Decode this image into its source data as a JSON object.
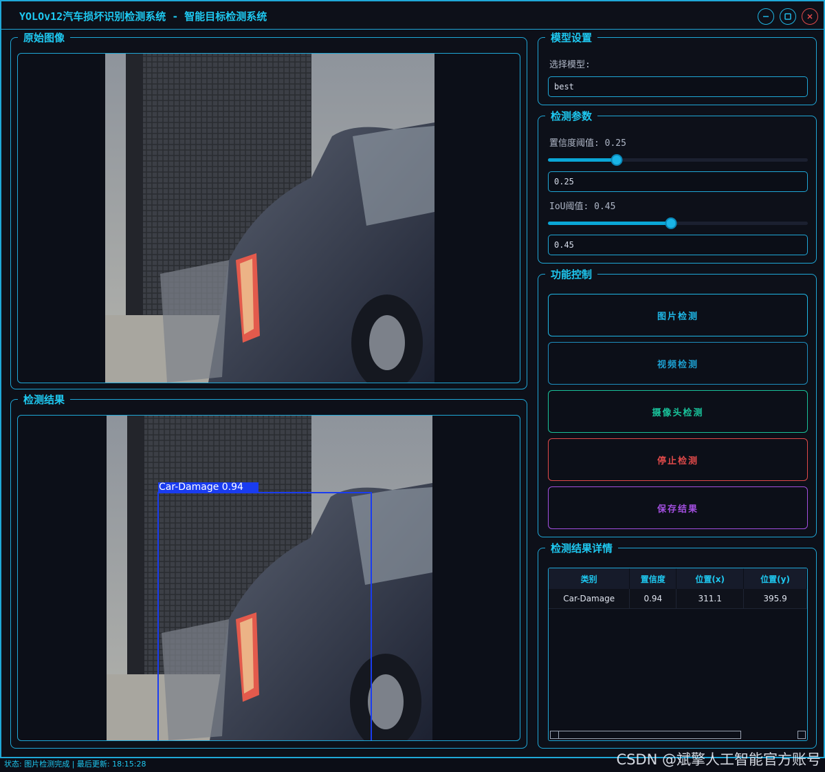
{
  "window": {
    "title": "YOLOv12汽车损坏识别检测系统 - 智能目标检测系统"
  },
  "panels": {
    "original_title": "原始图像",
    "result_title": "检测结果"
  },
  "detection_overlay": {
    "label": "Car-Damage 0.94"
  },
  "model_settings": {
    "title": "模型设置",
    "select_label": "选择模型:",
    "selected_model": "best"
  },
  "params": {
    "title": "检测参数",
    "conf_label": "置信度阈值: 0.25",
    "conf_value": "0.25",
    "conf_level": 0.25,
    "iou_label": "IoU阈值: 0.45",
    "iou_value": "0.45",
    "iou_level": 0.45
  },
  "controls": {
    "title": "功能控制",
    "image_detect": "图片检测",
    "video_detect": "视频检测",
    "camera_detect": "摄像头检测",
    "stop_detect": "停止检测",
    "save_result": "保存结果"
  },
  "details": {
    "title": "检测结果详情",
    "columns": [
      "类别",
      "置信度",
      "位置(x)",
      "位置(y)"
    ],
    "rows": [
      [
        "Car-Damage",
        "0.94",
        "311.1",
        "395.9"
      ]
    ]
  },
  "status": {
    "text": "状态: 图片检测完成 | 最后更新: 18:15:28"
  },
  "watermark": "CSDN @斌擎人工智能官方账号",
  "colors": {
    "accent": "#1ec8f0",
    "image_detect": "#1fb7e6",
    "camera_detect": "#19c29a",
    "stop_detect": "#e24a4a",
    "save_result": "#a34fe0",
    "bbox": "#1a3cf0"
  }
}
